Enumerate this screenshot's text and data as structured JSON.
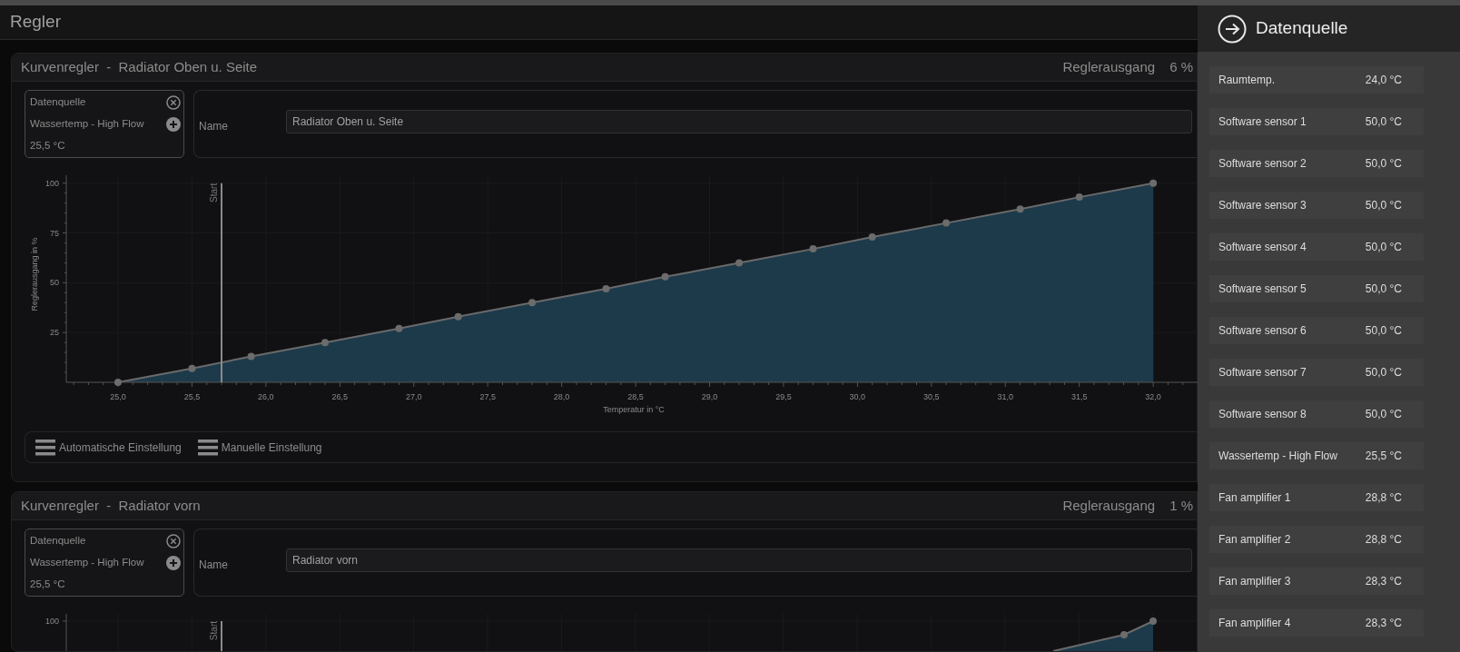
{
  "page_title": "Regler",
  "controllers": [
    {
      "title": "Kurvenregler  -  Radiator Oben u. Seite",
      "output_label": "Reglerausgang",
      "output_value": "6 %",
      "datasource": {
        "label": "Datenquelle",
        "source": "Wassertemp - High Flow",
        "value": "25,5 °C"
      },
      "name_label": "Name",
      "name_value": "Radiator Oben u. Seite",
      "chart_data": {
        "type": "area",
        "xlabel": "Temperatur in °C",
        "ylabel": "Reglerausgang in %",
        "x": [
          25.0,
          25.5,
          25.9,
          26.4,
          26.9,
          27.3,
          27.8,
          28.3,
          28.7,
          29.2,
          29.7,
          30.1,
          30.6,
          31.1,
          31.5,
          32.0
        ],
        "series": [
          {
            "color": "#1d3a4b",
            "values": [
              0,
              7,
              13,
              20,
              27,
              33,
              40,
              47,
              53,
              60,
              67,
              73,
              80,
              87,
              93,
              100
            ]
          }
        ],
        "xlim": [
          24.65,
          32.3
        ],
        "ylim": [
          0,
          104
        ],
        "grid": true,
        "xticks": [
          {
            "value": 25.0,
            "label": "25,0"
          },
          {
            "value": 25.5,
            "label": "25,5"
          },
          {
            "value": 26.0,
            "label": "26,0"
          },
          {
            "value": 26.5,
            "label": "26,5"
          },
          {
            "value": 27.0,
            "label": "27,0"
          },
          {
            "value": 27.5,
            "label": "27,5"
          },
          {
            "value": 28.0,
            "label": "28,0"
          },
          {
            "value": 28.5,
            "label": "28,5"
          },
          {
            "value": 29.0,
            "label": "29,0"
          },
          {
            "value": 29.5,
            "label": "29,5"
          },
          {
            "value": 30.0,
            "label": "30,0"
          },
          {
            "value": 30.5,
            "label": "30,5"
          },
          {
            "value": 31.0,
            "label": "31,0"
          },
          {
            "value": 31.5,
            "label": "31,5"
          },
          {
            "value": 32.0,
            "label": "32,0"
          }
        ],
        "yticks": [
          25,
          50,
          75,
          100
        ],
        "ref_lines": [
          {
            "axis": "x",
            "value": 25.7,
            "label": "Start"
          }
        ]
      },
      "buttons": [
        "Automatische Einstellung",
        "Manuelle Einstellung"
      ]
    },
    {
      "title": "Kurvenregler  -  Radiator vorn",
      "output_label": "Reglerausgang",
      "output_value": "1 %",
      "datasource": {
        "label": "Datenquelle",
        "source": "Wassertemp - High Flow",
        "value": "25,5 °C"
      },
      "name_label": "Name",
      "name_value": "Radiator vorn",
      "chart_preview": {
        "tick_label": "100",
        "marker_label": "Start"
      }
    }
  ],
  "datasource_panel": {
    "title": "Datenquelle",
    "items": [
      {
        "name": "Raumtemp.",
        "value": "24,0 °C"
      },
      {
        "name": "Software sensor 1",
        "value": "50,0 °C"
      },
      {
        "name": "Software sensor 2",
        "value": "50,0 °C"
      },
      {
        "name": "Software sensor 3",
        "value": "50,0 °C"
      },
      {
        "name": "Software sensor 4",
        "value": "50,0 °C"
      },
      {
        "name": "Software sensor 5",
        "value": "50,0 °C"
      },
      {
        "name": "Software sensor 6",
        "value": "50,0 °C"
      },
      {
        "name": "Software sensor 7",
        "value": "50,0 °C"
      },
      {
        "name": "Software sensor 8",
        "value": "50,0 °C"
      },
      {
        "name": "Wassertemp - High Flow",
        "value": "25,5 °C"
      },
      {
        "name": "Fan amplifier 1",
        "value": "28,8 °C"
      },
      {
        "name": "Fan amplifier 2",
        "value": "28,8 °C"
      },
      {
        "name": "Fan amplifier 3",
        "value": "28,3 °C"
      },
      {
        "name": "Fan amplifier 4",
        "value": "28,3 °C"
      }
    ]
  }
}
